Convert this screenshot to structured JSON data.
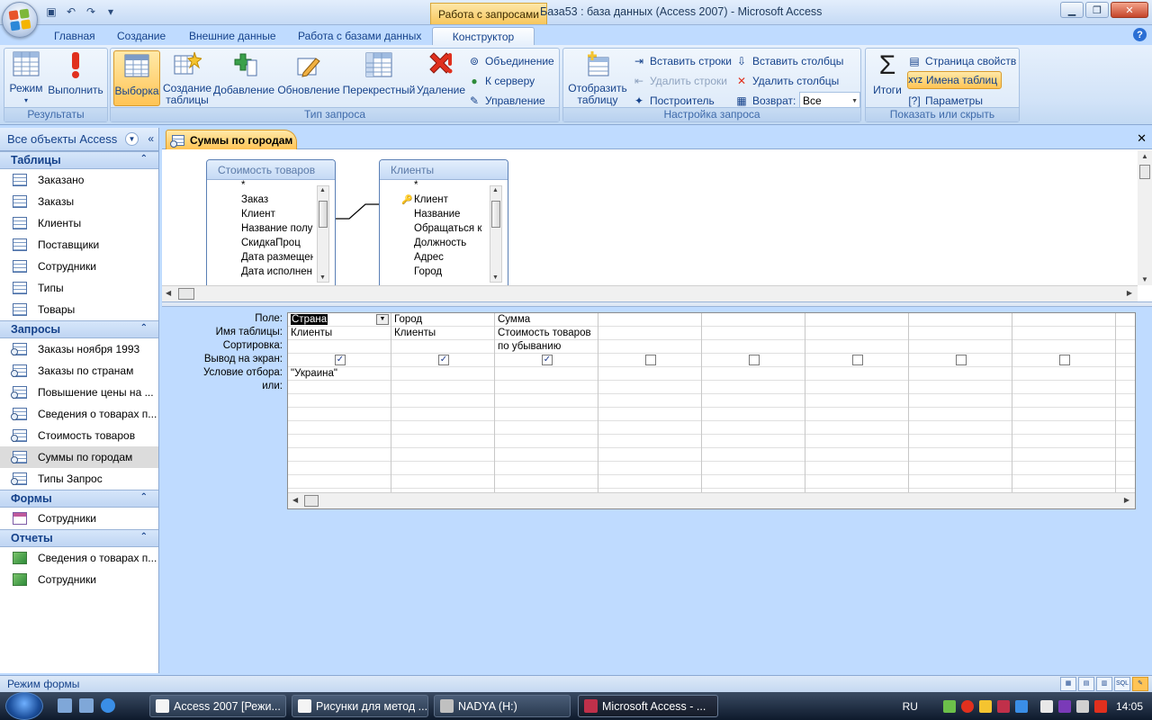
{
  "window": {
    "context_tab": "Работа с запросами",
    "title": "База53 : база данных (Access 2007)  -  Microsoft Access",
    "controls": [
      "minimize",
      "maximize",
      "close"
    ]
  },
  "quick_access": [
    "save-icon",
    "undo-icon",
    "redo-icon",
    "customize-icon"
  ],
  "ribbon_tabs": [
    {
      "label": "Главная",
      "active": false
    },
    {
      "label": "Создание",
      "active": false
    },
    {
      "label": "Внешние данные",
      "active": false
    },
    {
      "label": "Работа с базами данных",
      "active": false
    },
    {
      "label": "Конструктор",
      "active": true
    }
  ],
  "ribbon": {
    "results": {
      "label": "Результаты",
      "view": "Режим",
      "run": "Выполнить"
    },
    "query_type": {
      "label": "Тип запроса",
      "select": "Выборка",
      "make_table_1": "Создание",
      "make_table_2": "таблицы",
      "append": "Добавление",
      "update": "Обновление",
      "crosstab": "Перекрестный",
      "delete": "Удаление",
      "union": "Объединение",
      "passthrough": "К серверу",
      "data_definition": "Управление"
    },
    "query_setup": {
      "label": "Настройка запроса",
      "show_table_1": "Отобразить",
      "show_table_2": "таблицу",
      "insert_rows": "Вставить строки",
      "delete_rows": "Удалить строки",
      "builder": "Построитель",
      "insert_columns": "Вставить столбцы",
      "delete_columns": "Удалить столбцы",
      "return_label": "Возврат:",
      "return_value": "Все"
    },
    "show_hide": {
      "label": "Показать или скрыть",
      "totals": "Итоги",
      "property_sheet": "Страница свойств",
      "table_names": "Имена таблиц",
      "parameters": "Параметры"
    }
  },
  "nav": {
    "title": "Все объекты Access",
    "groups": [
      {
        "name": "Таблицы",
        "type": "table",
        "items": [
          "Заказано",
          "Заказы",
          "Клиенты",
          "Поставщики",
          "Сотрудники",
          "Типы",
          "Товары"
        ]
      },
      {
        "name": "Запросы",
        "type": "query",
        "items": [
          "Заказы ноября 1993",
          "Заказы по странам",
          "Повышение цены на ...",
          "Сведения о товарах п...",
          "Стоимость товаров",
          "Суммы по городам",
          "Типы Запрос"
        ],
        "selected": 5
      },
      {
        "name": "Формы",
        "type": "form",
        "items": [
          "Сотрудники"
        ]
      },
      {
        "name": "Отчеты",
        "type": "report",
        "items": [
          "Сведения о товарах п...",
          "Сотрудники"
        ]
      }
    ]
  },
  "document": {
    "tab": "Суммы по городам",
    "tables": [
      {
        "title": "Стоимость товаров",
        "fields": [
          "*",
          "Заказ",
          "Клиент",
          "Название полу",
          "СкидкаПроц",
          "Дата размещен",
          "Дата исполнен"
        ]
      },
      {
        "title": "Клиенты",
        "fields": [
          "*",
          "Клиент",
          "Название",
          "Обращаться к",
          "Должность",
          "Адрес",
          "Город"
        ]
      }
    ],
    "row_labels": [
      "Поле:",
      "Имя таблицы:",
      "Сортировка:",
      "Вывод на экран:",
      "Условие отбора:",
      "или:"
    ],
    "columns": [
      {
        "field": "Страна",
        "table": "Клиенты",
        "sort": "",
        "show": true,
        "criteria": "\"Украина\""
      },
      {
        "field": "Город",
        "table": "Клиенты",
        "sort": "",
        "show": true,
        "criteria": ""
      },
      {
        "field": "Сумма",
        "table": "Стоимость товаров",
        "sort": "по убыванию",
        "show": true,
        "criteria": ""
      },
      {
        "field": "",
        "table": "",
        "sort": "",
        "show": false,
        "criteria": ""
      },
      {
        "field": "",
        "table": "",
        "sort": "",
        "show": false,
        "criteria": ""
      },
      {
        "field": "",
        "table": "",
        "sort": "",
        "show": false,
        "criteria": ""
      },
      {
        "field": "",
        "table": "",
        "sort": "",
        "show": false,
        "criteria": ""
      },
      {
        "field": "",
        "table": "",
        "sort": "",
        "show": false,
        "criteria": ""
      },
      {
        "field": "",
        "table": "",
        "sort": "",
        "show": false,
        "criteria": ""
      }
    ]
  },
  "status": {
    "text": "Режим формы",
    "views": [
      "datasheet",
      "pivottable",
      "pivotchart",
      "sql",
      "design"
    ]
  },
  "taskbar": {
    "buttons": [
      "Access 2007 [Режи...",
      "Рисунки для метод ...",
      "NADYA (H:)",
      "Microsoft Access - ..."
    ],
    "lang": "RU",
    "time": "14:05"
  }
}
